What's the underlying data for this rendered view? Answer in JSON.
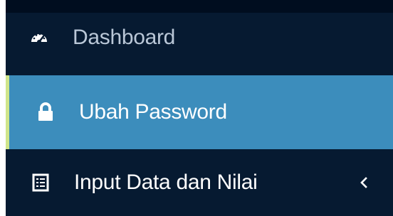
{
  "sidebar": {
    "items": [
      {
        "label": "Dashboard",
        "icon": "dashboard-icon",
        "active": false
      },
      {
        "label": "Ubah Password",
        "icon": "lock-icon",
        "active": true
      },
      {
        "label": "Input Data dan Nilai",
        "icon": "list-icon",
        "active": false,
        "expand_icon": "chevron-left-icon"
      }
    ]
  },
  "colors": {
    "sidebar_background": "#061a31",
    "active_background": "#3c8dbc",
    "active_accent": "#cfe58a",
    "text": "#ffffff"
  }
}
